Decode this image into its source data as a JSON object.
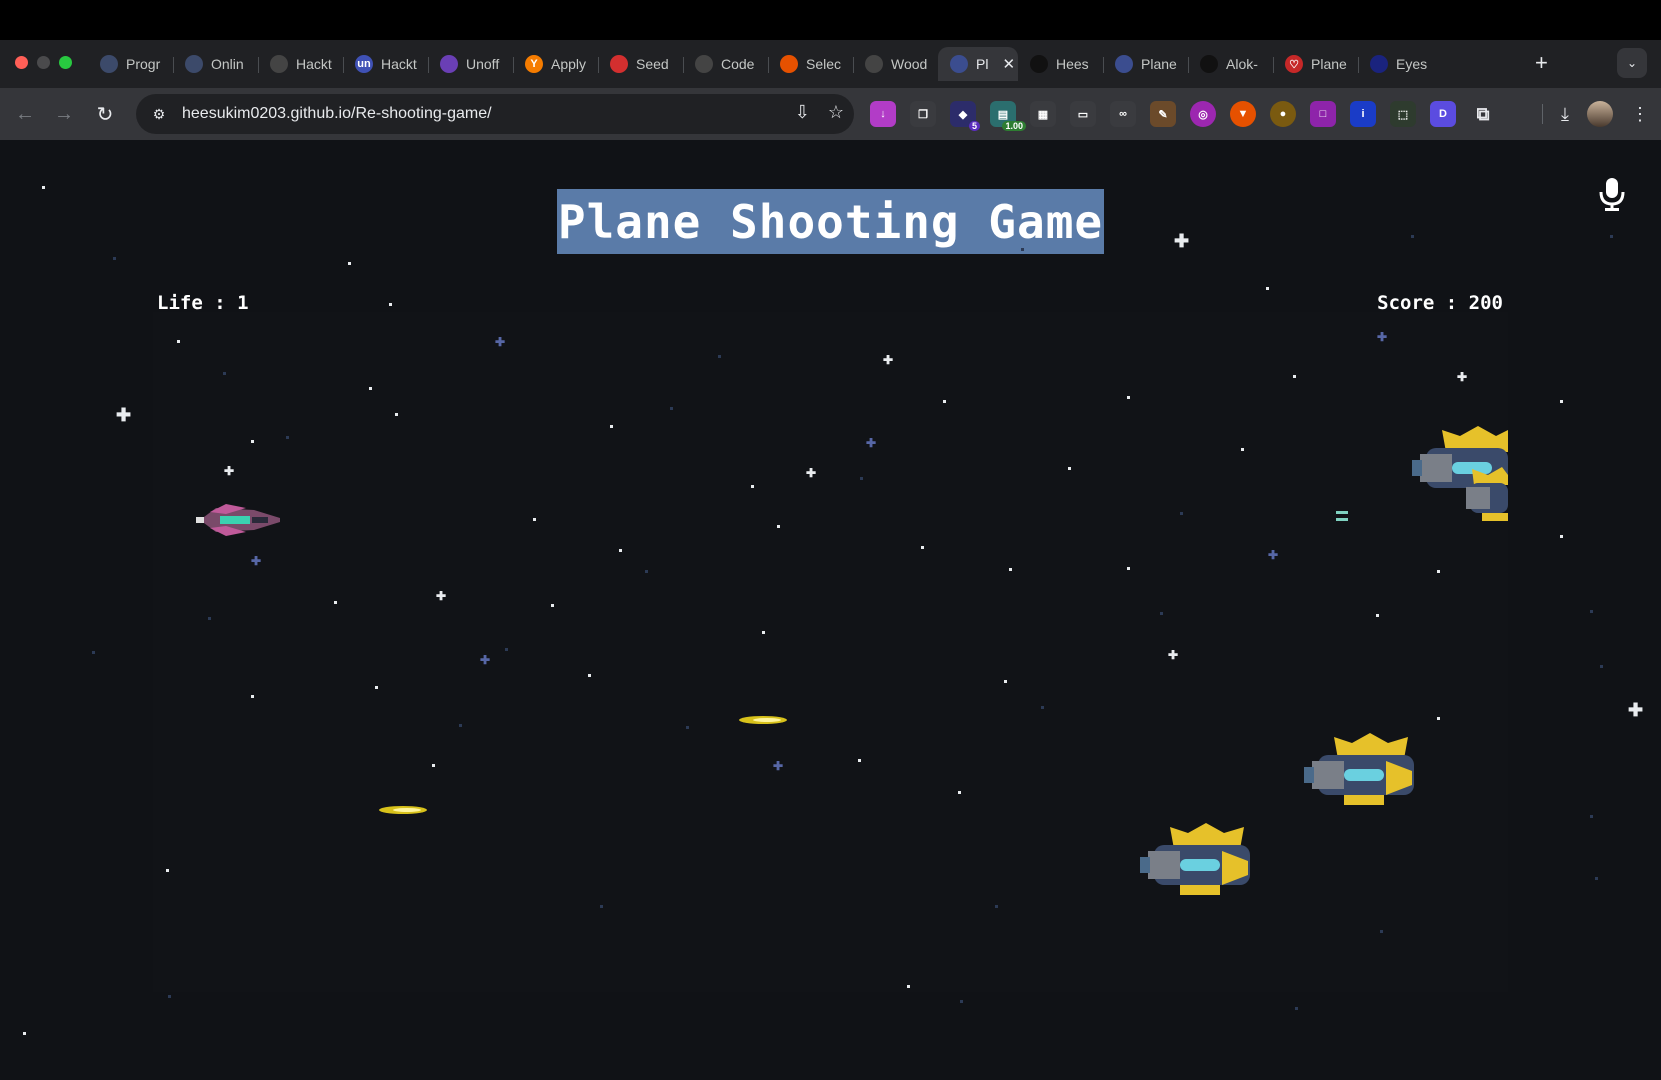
{
  "browser": {
    "tabs": [
      {
        "title": "Progr",
        "icon_color": "#3c4a6a",
        "icon_text": ""
      },
      {
        "title": "Onlin",
        "icon_color": "#3c4a6a",
        "icon_text": ""
      },
      {
        "title": "Hackt",
        "icon_color": "#444",
        "icon_text": ""
      },
      {
        "title": "Hackt",
        "icon_color": "#3f51b5",
        "icon_text": "un"
      },
      {
        "title": "Unoff",
        "icon_color": "#6a3fb5",
        "icon_text": ""
      },
      {
        "title": "Apply",
        "icon_color": "#f57c00",
        "icon_text": "Y"
      },
      {
        "title": "Seed",
        "icon_color": "#d32f2f",
        "icon_text": ""
      },
      {
        "title": "Code",
        "icon_color": "#444",
        "icon_text": ""
      },
      {
        "title": "Selec",
        "icon_color": "#e65100",
        "icon_text": ""
      },
      {
        "title": "Wood",
        "icon_color": "#444",
        "icon_text": ""
      },
      {
        "title": "Pl",
        "icon_color": "#3b4d8f",
        "icon_text": "",
        "active": true
      },
      {
        "title": "Hees",
        "icon_color": "#111",
        "icon_text": ""
      },
      {
        "title": "Plane",
        "icon_color": "#3b4d8f",
        "icon_text": ""
      },
      {
        "title": "Alok-",
        "icon_color": "#111",
        "icon_text": ""
      },
      {
        "title": "Plane",
        "icon_color": "#c62828",
        "icon_text": "♡"
      },
      {
        "title": "Eyes",
        "icon_color": "#1a237e",
        "icon_text": ""
      }
    ],
    "new_tab_label": "+",
    "url_host": "heesukim0203.github.io",
    "url_path": "/Re-shooting-game/",
    "extension_badge_count": "5",
    "extension_badge_value": "1.00"
  },
  "game": {
    "title": "Plane Shooting Game",
    "life_label": "Life : 1",
    "score_label": "Score : 200"
  }
}
